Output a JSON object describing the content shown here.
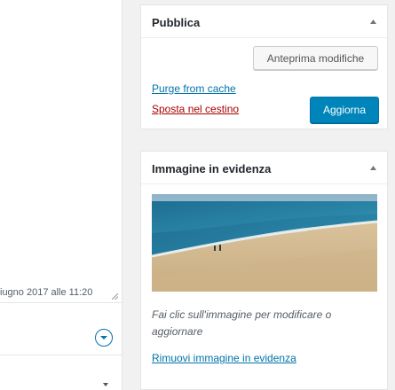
{
  "editor": {
    "date_text": "iugno 2017 alle 11:20"
  },
  "publish": {
    "title": "Pubblica",
    "preview_label": "Anteprima modifiche",
    "purge_label": "Purge from cache",
    "trash_label": "Sposta nel cestino",
    "update_label": "Aggiorna"
  },
  "featured": {
    "title": "Immagine in evidenza",
    "hint": "Fai clic sull'immagine per modificare o aggiornare",
    "remove_label": "Rimuovi immagine in evidenza"
  },
  "colors": {
    "primary": "#0085ba",
    "link": "#0073aa",
    "trash": "#aa0000"
  },
  "icons": [
    "caret-up-icon",
    "resize-handle-icon",
    "circle-chevron-down-icon",
    "caret-down-icon"
  ]
}
